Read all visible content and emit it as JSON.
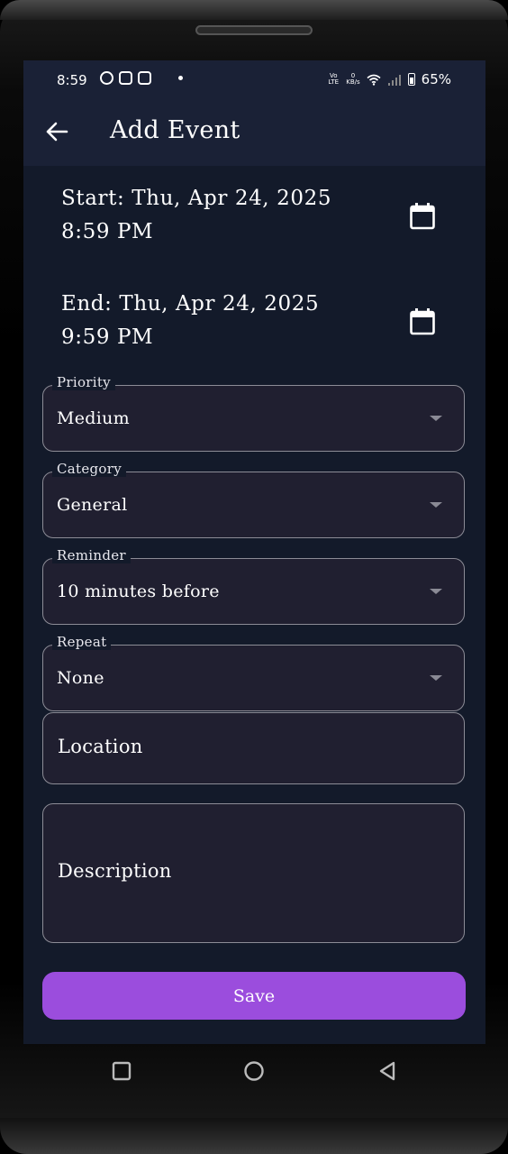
{
  "status_bar": {
    "time": "8:59",
    "network_label": "Vo LTE",
    "data_rate": "0",
    "data_rate_unit": "KB/s",
    "battery": "65%",
    "notification_icons": [
      "whatsapp-icon",
      "instagram-icon",
      "instagram-icon"
    ]
  },
  "app_bar": {
    "title": "Add Event"
  },
  "start": {
    "date_line": "Start: Thu, Apr 24, 2025",
    "time_line": "8:59 PM"
  },
  "end": {
    "date_line": "End: Thu, Apr 24, 2025",
    "time_line": "9:59 PM"
  },
  "priority": {
    "label": "Priority",
    "value": "Medium"
  },
  "category": {
    "label": "Category",
    "value": "General"
  },
  "reminder": {
    "label": "Reminder",
    "value": "10 minutes before"
  },
  "repeat": {
    "label": "Repeat",
    "value": "None"
  },
  "location": {
    "placeholder": "Location"
  },
  "description": {
    "placeholder": "Description"
  },
  "save_button": {
    "label": "Save"
  },
  "colors": {
    "background": "#131a2a",
    "app_bar": "#1a2136",
    "field_fill": "#201f30",
    "accent": "#9b4ddd"
  }
}
